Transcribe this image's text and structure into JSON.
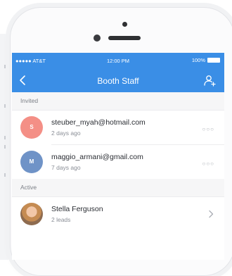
{
  "status_bar": {
    "carrier": "●●●●● AT&T",
    "time": "12:00 PM",
    "battery": "100%"
  },
  "nav": {
    "title": "Booth Staff",
    "back_icon": "chevron-left-icon",
    "action_icon": "add-user-icon"
  },
  "sections": {
    "invited": {
      "label": "Invited",
      "items": [
        {
          "initial": "S",
          "email": "steuber_myah@hotmail.com",
          "time": "2 days ago",
          "color": "#f48f86"
        },
        {
          "initial": "M",
          "email": "maggio_armani@gmail.com",
          "time": "7 days ago",
          "color": "#6f93c7"
        }
      ]
    },
    "active": {
      "label": "Active",
      "items": [
        {
          "name": "Stella Ferguson",
          "detail": "2 leads"
        }
      ]
    }
  },
  "more_label": "○○○",
  "colors": {
    "accent": "#3a8ee6"
  }
}
